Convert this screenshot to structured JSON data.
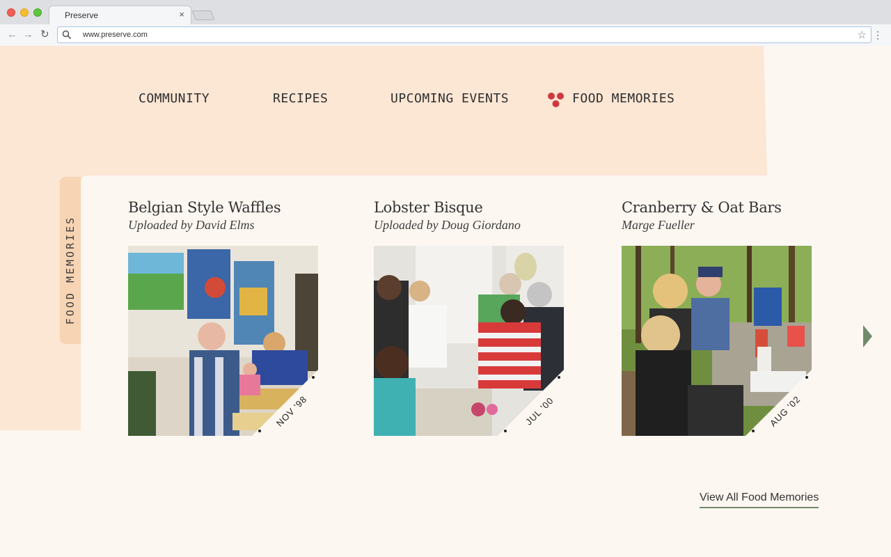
{
  "browser": {
    "tab_title": "Preserve",
    "tab_close": "×",
    "url": "www.preserve.com"
  },
  "nav": {
    "items": [
      {
        "label": "COMMUNITY",
        "active": false
      },
      {
        "label": "RECIPES",
        "active": false
      },
      {
        "label": "UPCOMING EVENTS",
        "active": false
      },
      {
        "label": "FOOD MEMORIES",
        "active": true
      }
    ],
    "active_marker_color": "#d0383f"
  },
  "section": {
    "side_tab_label": "FOOD MEMORIES"
  },
  "cards": [
    {
      "title": "Belgian Style Waffles",
      "subtitle": "Uploaded by David Elms",
      "date": "NOV '98"
    },
    {
      "title": "Lobster Bisque",
      "subtitle": "Uploaded by Doug Giordano",
      "date": "JUL '00"
    },
    {
      "title": "Cranberry & Oat Bars",
      "subtitle": "Marge Fueller",
      "date": "AUG '02"
    }
  ],
  "view_all_link": "View All Food Memories",
  "colors": {
    "peach": "#fce6d4",
    "cream": "#fdf7f1",
    "accent_green": "#6e8a6b",
    "accent_red": "#d0383f"
  }
}
